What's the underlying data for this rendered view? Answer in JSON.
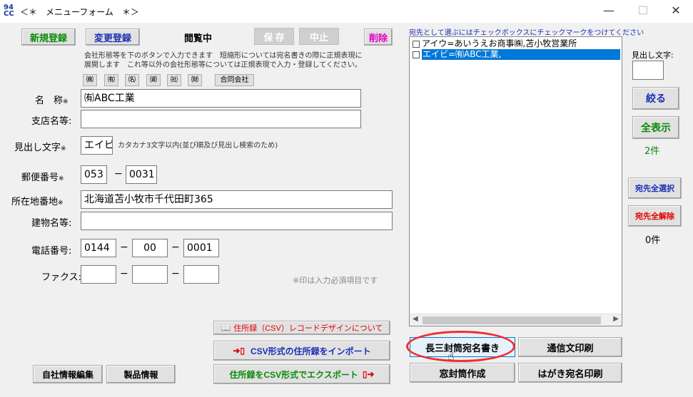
{
  "window": {
    "title": "＜＊　メニューフォーム　＊＞",
    "app_icon_text": "94 CC",
    "minimize": "—",
    "maximize": "☐",
    "close": "✕"
  },
  "toolbar": {
    "new": "新規登録",
    "edit": "変更登録",
    "mode": "閲覧中",
    "save": "保 存",
    "cancel": "中止",
    "delete": "削除"
  },
  "note": {
    "line1": "会社形態等を下のボタンで入力できます　短縮形については宛名書きの際に正規表現に",
    "line2": "展開します　これ等以外の会社形態等については正規表現で入力・登録してください。"
  },
  "company_types": [
    "㈱",
    "㈲",
    "㈴",
    "㈾",
    "㈳",
    "㈶"
  ],
  "company_type_godo": "合同会社",
  "form": {
    "name_label": "名　称",
    "name_req": "※",
    "name_value": "㈲ABC工業",
    "branch_label": "支店名等:",
    "branch_value": "",
    "kana_label": "見出し文字",
    "kana_req": "※",
    "kana_value": "エイビ",
    "kana_note": "カタカナ3文字以内(並び順及び見出し検索のため)",
    "zip_label": "郵便番号",
    "zip_req": "※",
    "zip1": "053",
    "zip2": "0031",
    "dash": "−",
    "address_label": "所在地番地",
    "address_req": "※",
    "address_value": "北海道苫小牧市千代田町365",
    "building_label": "建物名等:",
    "building_value": "",
    "tel_label": "電話番号:",
    "tel1": "0144",
    "tel2": "00",
    "tel3": "0001",
    "fax_label": "ファクス:",
    "fax1": "",
    "fax2": "",
    "fax3": "",
    "required_note": "※印は入力必須項目です"
  },
  "bottom_left": {
    "csv_design": "住所録（CSV）レコードデザインについて",
    "csv_import": "CSV形式の住所録をインポート",
    "csv_export": "住所録をCSV形式でエクスポート",
    "company_edit": "自社情報編集",
    "product_info": "製品情報"
  },
  "recipients": {
    "instruction": "宛先として選ぶにはチェックボックスにチェックマークをつけてください",
    "items": [
      {
        "label": "アイウ=あいうえお商事㈱,苫小牧営業所",
        "selected": false
      },
      {
        "label": "エイビ=㈲ABC工業,",
        "selected": true
      }
    ]
  },
  "right_panel": {
    "kana_search_label": "見出し文字:",
    "kana_search_value": "",
    "filter": "絞る",
    "show_all": "全表示",
    "count": "2件",
    "select_all": "宛先全選択",
    "clear_all": "宛先全解除",
    "selected_count": "0件"
  },
  "print_buttons": {
    "chokei3": "長三封筒宛名書き",
    "letter": "通信文印刷",
    "window_envelope": "窓封筒作成",
    "postcard": "はがき宛名印刷"
  },
  "colors": {
    "green": "#0a8a0a",
    "blue": "#1a2fb5",
    "magenta": "#e000c0",
    "red": "#e00000",
    "selection": "#0078d7",
    "highlight": "#ee3030"
  }
}
